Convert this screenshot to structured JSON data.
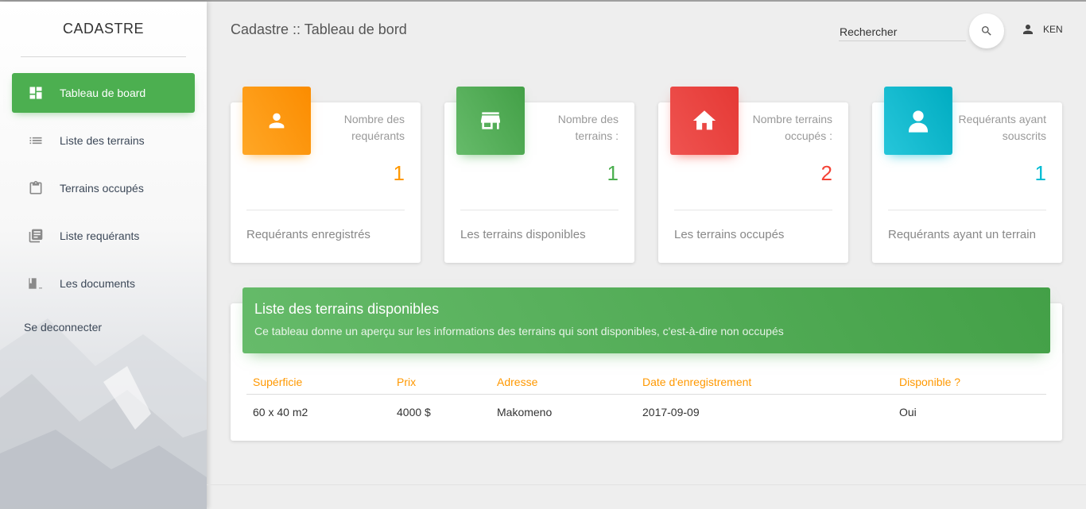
{
  "app": {
    "brand": "CADASTRE",
    "page_title": "Cadastre :: Tableau de bord"
  },
  "colors": {
    "accent_green": "#4caf50",
    "orange": "#ff9800",
    "red": "#f44336",
    "cyan": "#00bcd4"
  },
  "sidebar": {
    "items": [
      {
        "label": "Tableau de board",
        "icon": "dashboard-icon",
        "active": true
      },
      {
        "label": "Liste des terrains",
        "icon": "list-icon",
        "active": false
      },
      {
        "label": "Terrains occupés",
        "icon": "clipboard-icon",
        "active": false
      },
      {
        "label": "Liste requérants",
        "icon": "library-books-icon",
        "active": false
      },
      {
        "label": "Les documents",
        "icon": "book-icon",
        "active": false
      }
    ],
    "logout": "Se deconnecter"
  },
  "header": {
    "search_placeholder": "Rechercher",
    "user": "KEN"
  },
  "cards": [
    {
      "category": "Nombre des requérants",
      "value": "1",
      "footer": "Requérants enregistrés",
      "color": "#ff9800",
      "icon": "person-icon"
    },
    {
      "category": "Nombre des terrains :",
      "value": "1",
      "footer": "Les terrains disponibles",
      "color": "#4caf50",
      "icon": "store-icon"
    },
    {
      "category": "Nombre terrains occupés :",
      "value": "2",
      "footer": "Les terrains occupés",
      "color": "#f44336",
      "icon": "home-icon"
    },
    {
      "category": "Requérants ayant souscrits",
      "value": "1",
      "footer": "Requérants ayant un terrain",
      "color": "#00bcd4",
      "icon": "user-icon"
    }
  ],
  "table": {
    "title": "Liste des terrains disponibles",
    "subtitle": "Ce tableau donne un aperçu sur les informations des terrains qui sont disponibles, c'est-à-dire non occupés",
    "columns": [
      "Supérficie",
      "Prix",
      "Adresse",
      "Date d'enregistrement",
      "Disponible ?"
    ],
    "rows": [
      [
        "60 x 40 m2",
        "4000 $",
        "Makomeno",
        "2017-09-09",
        "Oui"
      ]
    ]
  }
}
